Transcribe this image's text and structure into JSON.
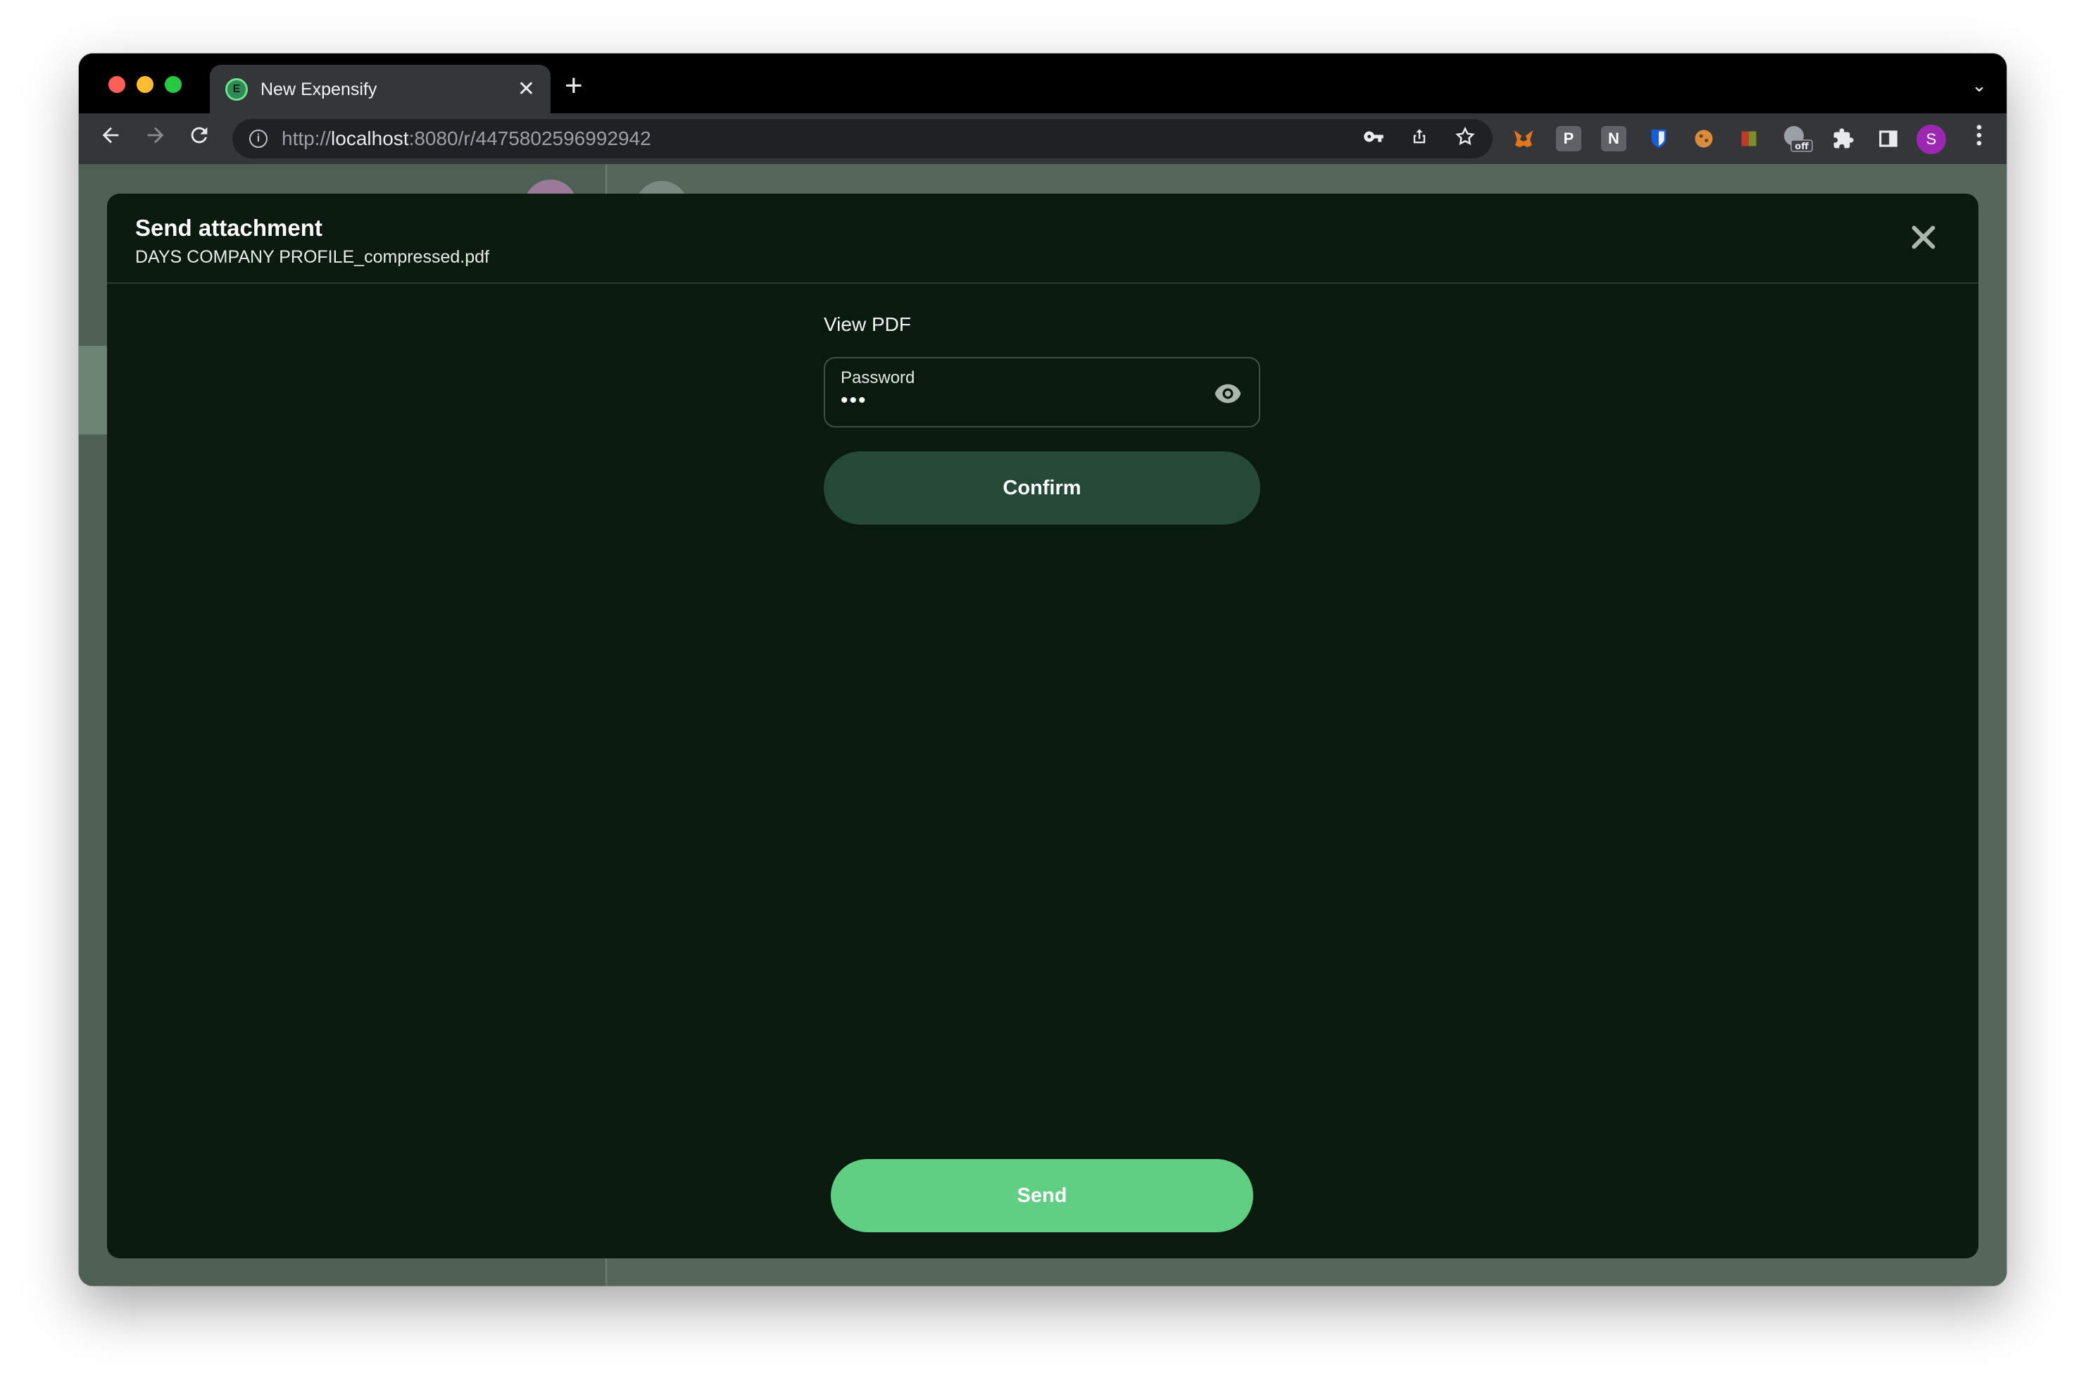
{
  "browser": {
    "tab": {
      "title": "New Expensify",
      "favicon_letter": "E",
      "close": "✕"
    },
    "new_tab": "+",
    "tab_menu": "⌄",
    "url_scheme": "http://",
    "url_host": "localhost",
    "url_rest": ":8080/r/4475802596992942",
    "profile_initial": "S",
    "extensions": [
      {
        "name": "metamask-extension-icon",
        "glyph": "🦊",
        "color": "#e2761b"
      },
      {
        "name": "p-extension-icon",
        "glyph": "P",
        "color": "#5f6368"
      },
      {
        "name": "notion-extension-icon",
        "glyph": "N",
        "color": "#5f6368"
      },
      {
        "name": "bitwarden-extension-icon",
        "glyph": "⛨",
        "color": "#175ddc"
      },
      {
        "name": "cookie-extension-icon",
        "glyph": "●",
        "color": "#d98c3a"
      },
      {
        "name": "color-extension-icon",
        "glyph": "▪",
        "color": "#c0392b"
      }
    ],
    "off_badge": "off"
  },
  "modal": {
    "title": "Send attachment",
    "filename": "DAYS COMPANY PROFILE_compressed.pdf",
    "heading": "View PDF",
    "password_label": "Password",
    "password_value": "•••",
    "confirm_label": "Confirm",
    "send_label": "Send"
  },
  "colors": {
    "modal_bg": "#0b1a0e",
    "confirm_bg": "#244a37",
    "send_bg": "#5fcf82"
  }
}
